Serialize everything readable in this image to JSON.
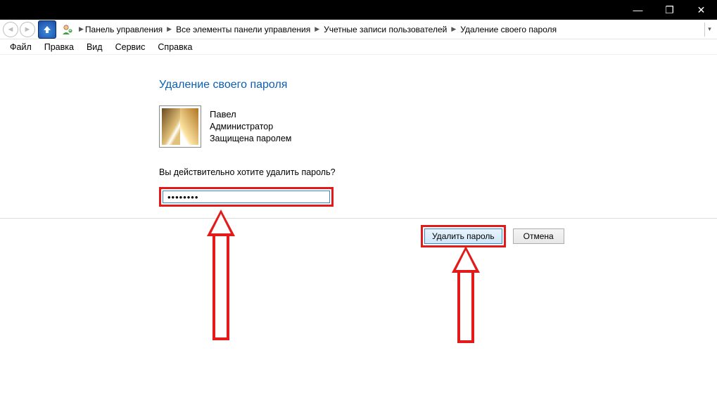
{
  "window": {
    "minimize": "—",
    "maximize": "❐",
    "close": "✕"
  },
  "breadcrumb": {
    "items": [
      "Панель управления",
      "Все элементы панели управления",
      "Учетные записи пользователей",
      "Удаление своего пароля"
    ]
  },
  "menu": {
    "file": "Файл",
    "edit": "Правка",
    "view": "Вид",
    "service": "Сервис",
    "help": "Справка"
  },
  "page": {
    "heading": "Удаление своего пароля",
    "user": {
      "name": "Павел",
      "role": "Администратор",
      "status": "Защищена паролем"
    },
    "prompt": "Вы действительно хотите удалить пароль?",
    "password_value": "••••••••",
    "delete_btn": "Удалить пароль",
    "cancel_btn": "Отмена"
  }
}
